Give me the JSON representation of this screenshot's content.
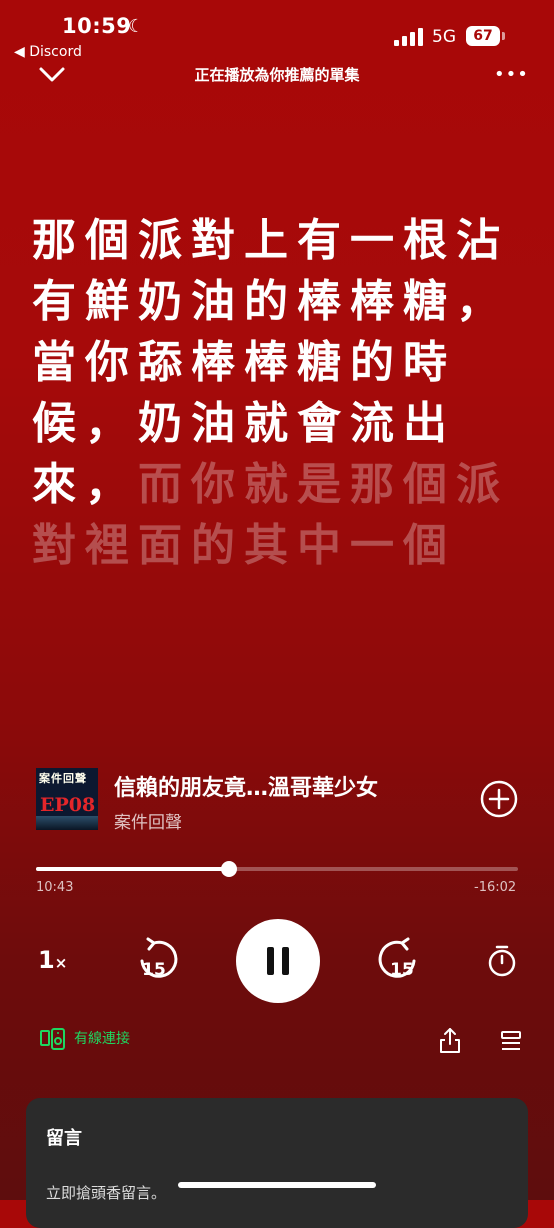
{
  "status": {
    "time": "10:59",
    "network": "5G",
    "battery": "67",
    "back_app": "◀ Discord"
  },
  "header": {
    "title": "正在播放為你推薦的單集"
  },
  "transcript": {
    "active": "那個派對上有一根沾有鮮奶油的棒棒糖，當你舔棒棒糖的時候，奶油就會流出來，",
    "upcoming": "而你就是那個派對裡面的其中一個"
  },
  "track": {
    "cover_text": "案件回聲",
    "cover_episode": "EP08",
    "title": "信賴的朋友竟…溫哥華少女",
    "artist": "案件回聲"
  },
  "progress": {
    "elapsed": "10:43",
    "remaining": "-16:02",
    "fraction": 0.4
  },
  "controls": {
    "speed": "1",
    "speed_suffix": "×",
    "skip_back": "15",
    "skip_forward": "15"
  },
  "connection": {
    "label": "有線連接"
  },
  "comments": {
    "title": "留言",
    "placeholder": "立即搶頭香留言。"
  }
}
